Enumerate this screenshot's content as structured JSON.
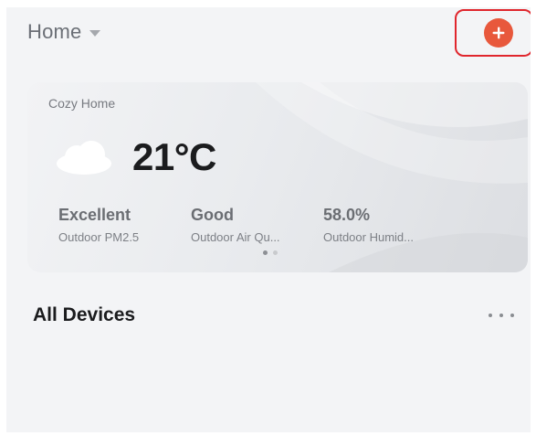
{
  "header": {
    "home_label": "Home",
    "add_icon": "plus-circle-icon",
    "accent_color": "#e8583c",
    "highlight_color": "#e0262d"
  },
  "weather_card": {
    "home_name": "Cozy Home",
    "weather_icon": "cloud-icon",
    "temperature": "21°C",
    "metrics": [
      {
        "value": "Excellent",
        "label": "Outdoor PM2.5"
      },
      {
        "value": "Good",
        "label": "Outdoor Air Qu..."
      },
      {
        "value": "58.0%",
        "label": "Outdoor Humid..."
      }
    ],
    "pager": {
      "pages": 2,
      "active_page": 1
    }
  },
  "devices": {
    "title": "All Devices",
    "more_icon": "more-horizontal-icon"
  }
}
